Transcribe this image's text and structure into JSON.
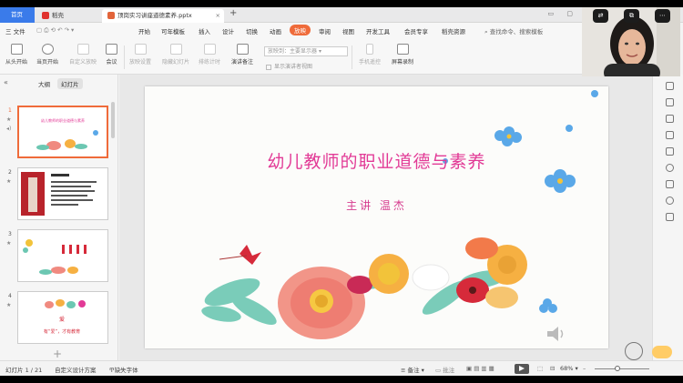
{
  "tabs": {
    "home": "首页",
    "docer": "稻壳",
    "doc": "顶岗实习讲座道德素养.pptx"
  },
  "menu": {
    "file": "三 文件",
    "items": [
      "开始",
      "插入",
      "设计",
      "切换",
      "动画",
      "放映",
      "审阅",
      "视图",
      "开发工具",
      "会员专享",
      "稻壳资源"
    ],
    "active": "放映",
    "extra_left": "可年模板",
    "search": "查找命令、搜索模板"
  },
  "ribbon": {
    "from_start": "从头开始",
    "from_current": "当页开始",
    "custom_show": "自定义放映",
    "meeting": "会议",
    "show_settings": "放映设置",
    "hide_slide": "隐藏幻灯片",
    "rehearse": "排练计时",
    "speaker_notes": "演讲备注",
    "show_to_label": "放映到：",
    "show_to_value": "主要显示器",
    "presenter_view": "显示演讲者视图",
    "phone_remote": "手机遥控",
    "screen_record": "屏幕录制"
  },
  "leftpanel": {
    "tab_outline": "大纲",
    "tab_slides": "幻灯片",
    "thumb_numbers": [
      "1",
      "2",
      "3",
      "4"
    ],
    "thumb1_title": "幼儿教师的职业道德与素养",
    "thumb4_text": "有“爱”，才有教育"
  },
  "slide": {
    "title": "幼儿教师的职业道德与素养",
    "subtitle": "主讲  温杰"
  },
  "statusbar": {
    "slide_counter": "幻灯片 1 / 21",
    "design": "自定义设计方案",
    "missing_font": "缺失字体",
    "notes": "备注",
    "comments": "批注",
    "zoom": "68%"
  },
  "colors": {
    "accent": "#ef6b3a",
    "home_tab": "#3a7bea",
    "title_pink": "#e23a96"
  }
}
